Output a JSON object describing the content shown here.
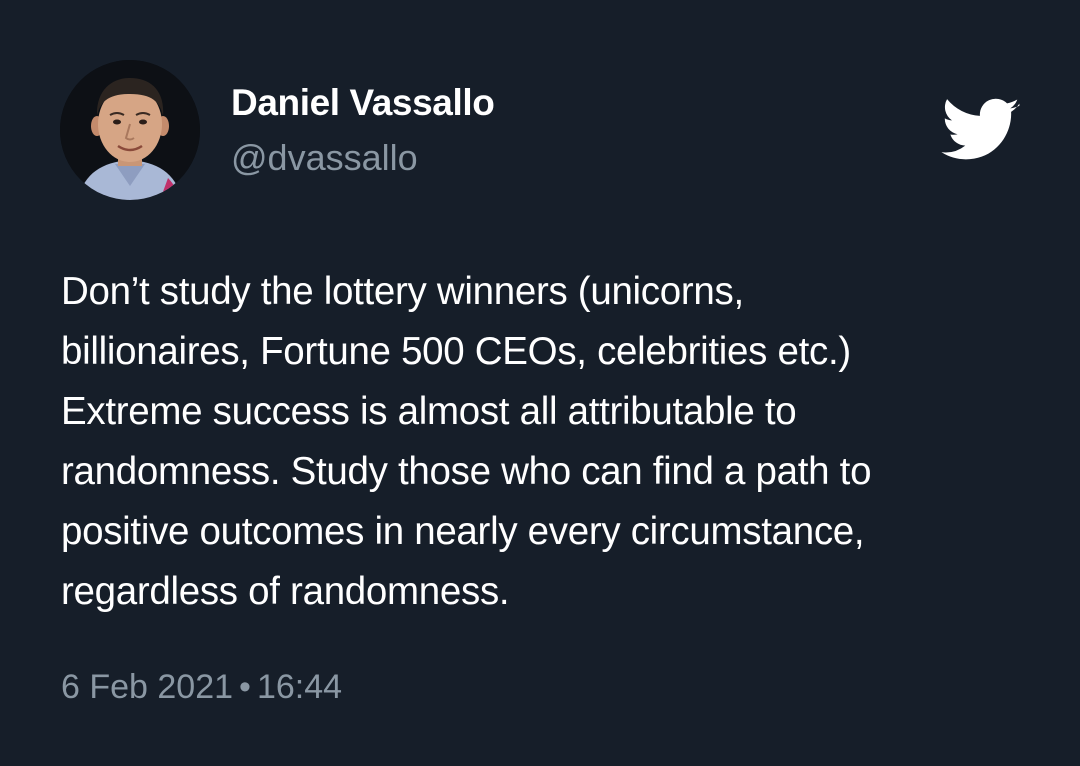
{
  "author": {
    "name": "Daniel Vassallo",
    "handle": "@dvassallo",
    "avatar_icon": "profile-photo"
  },
  "brand_icon": "twitter-bird-icon",
  "colors": {
    "background": "#161e29",
    "text": "#ffffff",
    "muted": "#8a97a3"
  },
  "tweet": {
    "lines": [
      "Don’t study the lottery winners (unicorns,",
      "billionaires, Fortune 500 CEOs, celebrities etc.)",
      "Extreme success is almost all attributable to",
      "randomness. Study those who can find a path to",
      "positive outcomes in nearly every circumstance,",
      "regardless of randomness."
    ]
  },
  "timestamp": {
    "date": "6 Feb 2021",
    "separator": "•",
    "time": "16:44"
  }
}
